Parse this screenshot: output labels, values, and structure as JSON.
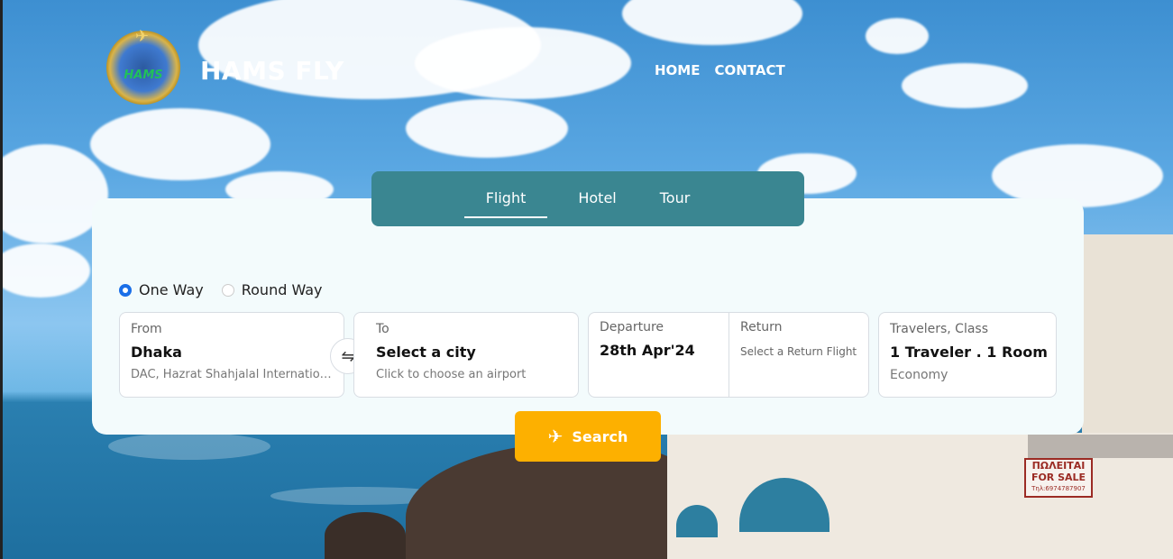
{
  "brand": {
    "name": "HAMS FLY",
    "logo_text": "HAMS"
  },
  "nav": {
    "items": [
      "HOME",
      "CONTACT"
    ]
  },
  "tabs": [
    {
      "label": "Flight",
      "active": true
    },
    {
      "label": "Hotel",
      "active": false
    },
    {
      "label": "Tour",
      "active": false
    }
  ],
  "trip_type": {
    "options": [
      {
        "label": "One Way",
        "selected": true
      },
      {
        "label": "Round Way",
        "selected": false
      }
    ]
  },
  "from": {
    "label": "From",
    "city": "Dhaka",
    "airport": "DAC, Hazrat Shahjalal International Airport"
  },
  "to": {
    "label": "To",
    "city": "Select a city",
    "hint": "Click to choose an airport"
  },
  "departure": {
    "label": "Departure",
    "date": "28th Apr'24"
  },
  "return": {
    "label": "Return",
    "hint": "Select a Return Flight"
  },
  "travelers": {
    "label": "Travelers, Class",
    "value": "1 Traveler . 1 Room",
    "class": "Economy"
  },
  "search": {
    "label": "Search"
  },
  "sign": {
    "line1": "ΠΩΛΕΙΤΑΙ",
    "line2": "FOR SALE",
    "line3": "Τηλ:6974787907"
  },
  "colors": {
    "tab_bar": "#3a8691",
    "search_button": "#fdb000",
    "radio_selected": "#1a6fe8"
  }
}
